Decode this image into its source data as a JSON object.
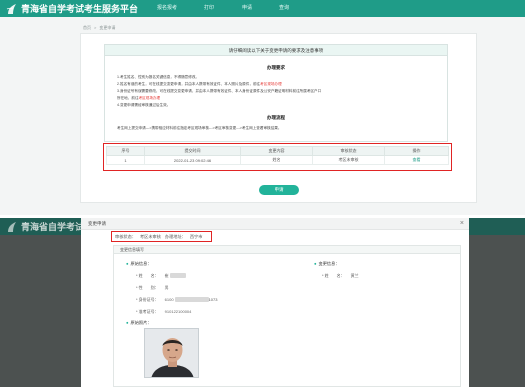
{
  "app": {
    "title": "青海省自学考试考生服务平台",
    "nav": [
      "报名报考",
      "打印",
      "申请",
      "查询"
    ]
  },
  "breadcrumb": {
    "home": "首页",
    "current": "变更申请"
  },
  "notice": {
    "header": "请仔细阅读以下关于变更申请的要求及注意事项",
    "section1_title": "办理要求",
    "lines": [
      "1.考生姓名、性别为报名关键信息，不得随意修改。",
      "2.姓名有误的考生，可在线提交变更申请，并由本人携带有效证件、本人照片及原件，前往",
      "3.身份证号有误需要修改，可在线提交变更申请，并由本人携带有效证件、本人身份证原件及公安户籍证明材料前往所属考区户口",
      "    所在地，前往",
      "4.变更申请需经审核通过后生效。"
    ],
    "highlight": "考区现场办理",
    "section2_title": "办理流程",
    "flow": "考生网上提交申请--->携带相应材料前往指定考区现场审核--->考区审核变更--->考生网上查看审核结果。"
  },
  "table": {
    "headers": [
      "序号",
      "提交时间",
      "变更内容",
      "审核状态",
      "操作"
    ],
    "rows": [
      [
        "1",
        "2022-01-23 09:02:46",
        "姓名",
        "考区未审核",
        "查看"
      ]
    ]
  },
  "main_button": "申请",
  "modal": {
    "title": "变更申请",
    "close": "×",
    "status_items": [
      "审核状态：",
      "考区未审核",
      "办理地址：",
      "西宁市"
    ],
    "section_header": "变更信息填写",
    "original": {
      "title": "原始信息：",
      "fields": [
        {
          "label": "* 姓　　名：",
          "value": "崔"
        },
        {
          "label": "* 性　　别：",
          "value": "男"
        },
        {
          "label": "* 身份证号：",
          "value": "6100",
          "suffix": "1073"
        },
        {
          "label": "* 准考证号：",
          "value": "910122100004"
        }
      ],
      "photo_label": "原始照片："
    },
    "changed": {
      "title": "变更信息：",
      "fields": [
        {
          "label": "* 姓　　名：",
          "value": "黄兰"
        }
      ]
    }
  }
}
